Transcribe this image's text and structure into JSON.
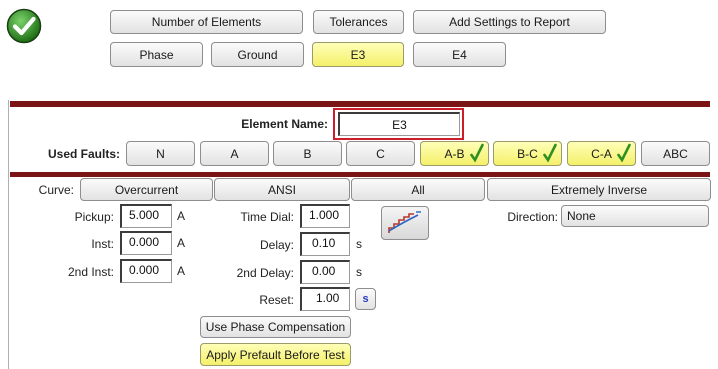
{
  "top_buttons": {
    "number_of_elements": "Number of Elements",
    "tolerances": "Tolerances",
    "add_settings_to_report": "Add Settings to Report"
  },
  "element_tabs": [
    "Phase",
    "Ground",
    "E3",
    "E4"
  ],
  "selected_element_tab": "E3",
  "element_name": {
    "label": "Element Name:",
    "value": "E3"
  },
  "used_faults": {
    "label": "Used Faults:",
    "items": [
      {
        "label": "N",
        "checked": false
      },
      {
        "label": "A",
        "checked": false
      },
      {
        "label": "B",
        "checked": false
      },
      {
        "label": "C",
        "checked": false
      },
      {
        "label": "A-B",
        "checked": true
      },
      {
        "label": "B-C",
        "checked": true
      },
      {
        "label": "C-A",
        "checked": true
      },
      {
        "label": "ABC",
        "checked": false
      }
    ]
  },
  "curve": {
    "label": "Curve:",
    "type": "Overcurrent",
    "standard": "ANSI",
    "filter": "All",
    "characteristic": "Extremely Inverse"
  },
  "pickup": {
    "label": "Pickup:",
    "value": "5.000",
    "unit": "A"
  },
  "inst": {
    "label": "Inst:",
    "value": "0.000",
    "unit": "A"
  },
  "inst2": {
    "label": "2nd Inst:",
    "value": "0.000",
    "unit": "A"
  },
  "time_dial": {
    "label": "Time Dial:",
    "value": "1.000"
  },
  "delay": {
    "label": "Delay:",
    "value": "0.10",
    "unit": "s"
  },
  "delay2": {
    "label": "2nd Delay:",
    "value": "0.00",
    "unit": "s"
  },
  "reset": {
    "label": "Reset:",
    "value": "1.00",
    "unit_button": "s"
  },
  "direction": {
    "label": "Direction:",
    "value": "None"
  },
  "use_phase_compensation": "Use Phase Compensation",
  "apply_prefault": "Apply Prefault Before Test",
  "icons": {
    "status": "green-checkmark-icon",
    "curve_graph": "curve-graph-icon",
    "fault_check": "checkmark-icon"
  },
  "colors": {
    "divider": "#7b1414",
    "selected": "#f4f06a",
    "highlight_border": "#cc1e2a",
    "success": "#2f8f1f"
  }
}
